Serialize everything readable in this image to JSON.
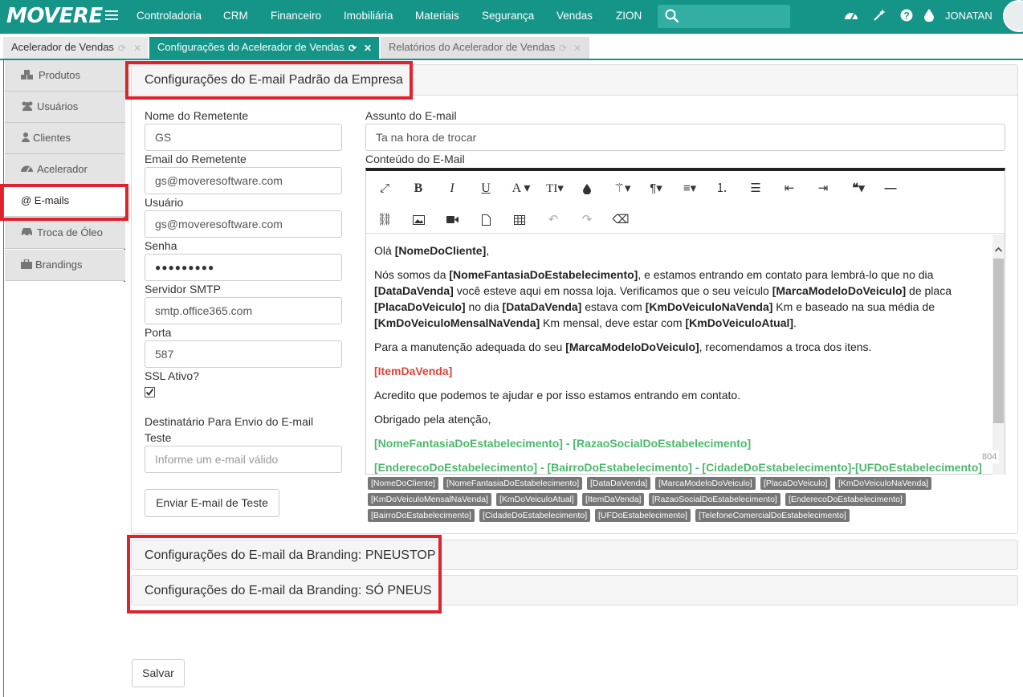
{
  "navbar": {
    "logo": "MOVERE",
    "items": [
      "Controladoria",
      "CRM",
      "Financeiro",
      "Imobiliária",
      "Materiais",
      "Segurança",
      "Vendas",
      "ZION"
    ],
    "user": "JONATAN"
  },
  "tabs": [
    {
      "label": "Acelerador de Vendas"
    },
    {
      "label": "Configurações do Acelerador de Vendas"
    },
    {
      "label": "Relatórios do Acelerador de Vendas"
    }
  ],
  "sidebar": {
    "items": [
      {
        "label": "Produtos",
        "icon": "cubes-icon"
      },
      {
        "label": "Usuários",
        "icon": "users-icon"
      },
      {
        "label": "Clientes",
        "icon": "user-icon"
      },
      {
        "label": "Acelerador",
        "icon": "dashboard-icon"
      },
      {
        "label": "@ E-mails",
        "icon": "at-icon"
      },
      {
        "label": "Troca de Óleo",
        "icon": "car-icon"
      },
      {
        "label": "Brandings",
        "icon": "briefcase-icon"
      }
    ]
  },
  "panel": {
    "title": "Configurações do E-mail Padrão da Empresa",
    "form": {
      "sender_name_label": "Nome do Remetente",
      "sender_name_value": "GS",
      "sender_email_label": "Email do Remetente",
      "sender_email_value": "gs@moveresoftware.com",
      "user_label": "Usuário",
      "user_value": "gs@moveresoftware.com",
      "password_label": "Senha",
      "password_value": "●●●●●●●●●",
      "smtp_label": "Servidor SMTP",
      "smtp_value": "smtp.office365.com",
      "port_label": "Porta",
      "port_value": "587",
      "ssl_label": "SSL Ativo?",
      "ssl_checked": true,
      "test_recipient_label_1": "Destinatário Para Envio do E-mail",
      "test_recipient_label_2": "Teste",
      "test_recipient_placeholder": "Informe um e-mail válido",
      "send_test_button": "Enviar E-mail de Teste",
      "subject_label": "Assunto do E-mail",
      "subject_value": "Ta na hora de trocar",
      "content_label": "Conteúdo do E-Mail"
    },
    "editor": {
      "p1_a": "Olá ",
      "p1_b": "[NomeDoCliente]",
      "p1_c": ",",
      "p2": [
        {
          "t": "Nós somos da ",
          "b": false
        },
        {
          "t": "[NomeFantasiaDoEstabelecimento]",
          "b": true
        },
        {
          "t": ", e estamos entrando em contato para lembrá-lo que no dia ",
          "b": false
        },
        {
          "t": "[DataDaVenda]",
          "b": true
        },
        {
          "t": " você esteve aqui em nossa loja. Verificamos que o seu veículo ",
          "b": false
        },
        {
          "t": "[MarcaModeloDoVeiculo]",
          "b": true
        },
        {
          "t": " de placa ",
          "b": false
        },
        {
          "t": "[PlacaDoVeiculo]",
          "b": true
        },
        {
          "t": " no dia ",
          "b": false
        },
        {
          "t": "[DataDaVenda]",
          "b": true
        },
        {
          "t": " estava com ",
          "b": false
        },
        {
          "t": "[KmDoVeiculoNaVenda]",
          "b": true
        },
        {
          "t": " Km e baseado na sua média de ",
          "b": false
        },
        {
          "t": "[KmDoVeiculoMensalNaVenda]",
          "b": true
        },
        {
          "t": " Km mensal, deve estar com ",
          "b": false
        },
        {
          "t": "[KmDoVeiculoAtual]",
          "b": true
        },
        {
          "t": ".",
          "b": false
        }
      ],
      "p3_a": "Para a manutenção adequada do seu ",
      "p3_b": "[MarcaModeloDoVeiculo]",
      "p3_c": ", recomendamos a troca dos itens.",
      "p4": "[ItemDaVenda]",
      "p5": "Acredito que podemos te ajudar e por isso estamos entrando em contato.",
      "p6": "Obrigado pela atenção,",
      "p7": "[NomeFantasiaDoEstabelecimento] - [RazaoSocialDoEstabelecimento]",
      "p8": "[EnderecoDoEstabelecimento] - [BairroDoEstabelecimento] - [CidadeDoEstabelecimento]-[UFDoEstabelecimento]",
      "counter": "804",
      "highlight_red": "#d9453a",
      "highlight_green": "#4cb86c"
    },
    "tags": [
      "[NomeDoCliente]",
      "[NomeFantasiaDoEstabelecimento]",
      "[DataDaVenda]",
      "[MarcaModeloDoVeiculo]",
      "[PlacaDoVeiculo]",
      "[KmDoVeiculoNaVenda]",
      "[KmDoVeiculoMensalNaVenda]",
      "[KmDoVeiculoAtual]",
      "[ItemDaVenda]",
      "[RazaoSocialDoEstabelecimento]",
      "[EnderecoDoEstabelecimento]",
      "[BairroDoEstabelecimento]",
      "[CidadeDoEstabelecimento]",
      "[UFDoEstabelecimento]",
      "[TelefoneComercialDoEstabelecimento]"
    ]
  },
  "branding_sections": [
    "Configurações do E-mail da Branding: PNEUSTOP",
    "Configurações do E-mail da Branding: SÓ PNEUS"
  ],
  "save_button": "Salvar",
  "colors": {
    "brand": "#159488",
    "highlight_box": "#e0222c"
  }
}
